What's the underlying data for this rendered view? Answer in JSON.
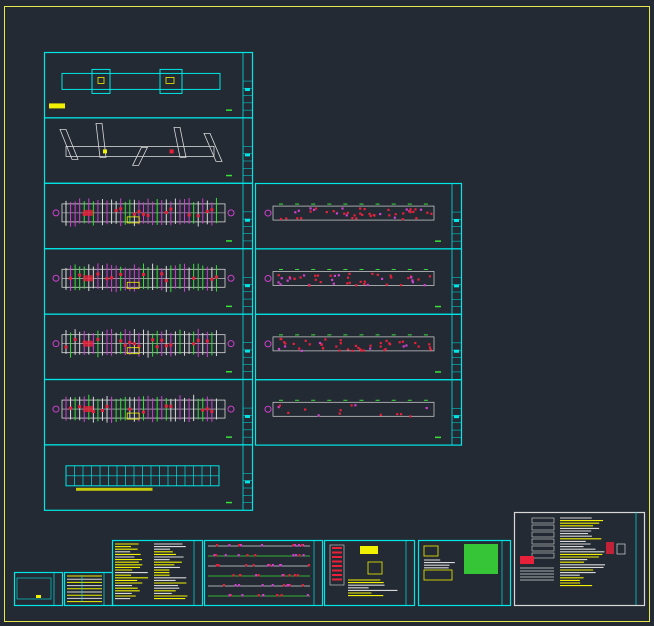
{
  "app": {
    "view": "model-space",
    "background_color": "#232a33"
  },
  "colors": {
    "border": "#e8e84a",
    "frame": "#00e5e5",
    "plan_white": "#d8d8d8",
    "red": "#e8203a",
    "magenta": "#d040d0",
    "green": "#38e038",
    "yellow": "#f0f000"
  },
  "sheets_left_column": [
    {
      "name": "sheet-site-plan",
      "kind": "site"
    },
    {
      "name": "sheet-roof-plan",
      "kind": "roof"
    },
    {
      "name": "sheet-floor-plan-1",
      "kind": "floor"
    },
    {
      "name": "sheet-floor-plan-2",
      "kind": "floor"
    },
    {
      "name": "sheet-floor-plan-3",
      "kind": "floor"
    },
    {
      "name": "sheet-floor-plan-4",
      "kind": "floor"
    },
    {
      "name": "sheet-grid-plan",
      "kind": "grid"
    }
  ],
  "sheets_right_column": [
    {
      "name": "sheet-electrical-plan-1",
      "kind": "elec"
    },
    {
      "name": "sheet-electrical-plan-2",
      "kind": "elec"
    },
    {
      "name": "sheet-electrical-plan-3",
      "kind": "elec"
    },
    {
      "name": "sheet-electrical-plan-4",
      "kind": "elec2"
    }
  ],
  "bottom_sheets": [
    {
      "name": "sheet-cover",
      "kind": "cover"
    },
    {
      "name": "sheet-index",
      "kind": "index"
    },
    {
      "name": "sheet-notes",
      "kind": "notes"
    },
    {
      "name": "sheet-riser-diagram",
      "kind": "riser"
    },
    {
      "name": "sheet-detail-a",
      "kind": "detailA"
    },
    {
      "name": "sheet-detail-b",
      "kind": "detailB"
    },
    {
      "name": "sheet-legend",
      "kind": "legend"
    }
  ]
}
